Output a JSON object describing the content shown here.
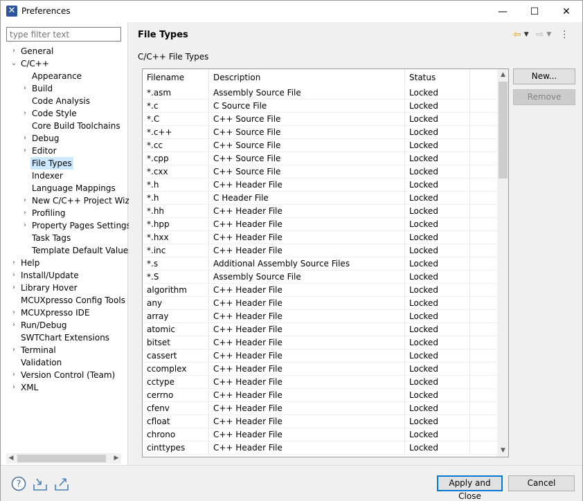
{
  "window": {
    "title": "Preferences",
    "controls": {
      "minimize": "—",
      "maximize": "☐",
      "close": "✕"
    }
  },
  "filter": {
    "placeholder": "type filter text"
  },
  "tree": [
    {
      "label": "General",
      "level": 0,
      "arrow": "›"
    },
    {
      "label": "C/C++",
      "level": 0,
      "arrow": "⌄"
    },
    {
      "label": "Appearance",
      "level": 1,
      "arrow": ""
    },
    {
      "label": "Build",
      "level": 1,
      "arrow": "›"
    },
    {
      "label": "Code Analysis",
      "level": 1,
      "arrow": ""
    },
    {
      "label": "Code Style",
      "level": 1,
      "arrow": "›"
    },
    {
      "label": "Core Build Toolchains",
      "level": 1,
      "arrow": ""
    },
    {
      "label": "Debug",
      "level": 1,
      "arrow": "›"
    },
    {
      "label": "Editor",
      "level": 1,
      "arrow": "›"
    },
    {
      "label": "File Types",
      "level": 1,
      "arrow": "",
      "selected": true
    },
    {
      "label": "Indexer",
      "level": 1,
      "arrow": ""
    },
    {
      "label": "Language Mappings",
      "level": 1,
      "arrow": ""
    },
    {
      "label": "New C/C++ Project Wiza",
      "level": 1,
      "arrow": "›"
    },
    {
      "label": "Profiling",
      "level": 1,
      "arrow": "›"
    },
    {
      "label": "Property Pages Settings",
      "level": 1,
      "arrow": "›"
    },
    {
      "label": "Task Tags",
      "level": 1,
      "arrow": ""
    },
    {
      "label": "Template Default Values",
      "level": 1,
      "arrow": ""
    },
    {
      "label": "Help",
      "level": 0,
      "arrow": "›"
    },
    {
      "label": "Install/Update",
      "level": 0,
      "arrow": "›"
    },
    {
      "label": "Library Hover",
      "level": 0,
      "arrow": "›"
    },
    {
      "label": "MCUXpresso Config Tools",
      "level": 0,
      "arrow": ""
    },
    {
      "label": "MCUXpresso IDE",
      "level": 0,
      "arrow": "›"
    },
    {
      "label": "Run/Debug",
      "level": 0,
      "arrow": "›"
    },
    {
      "label": "SWTChart Extensions",
      "level": 0,
      "arrow": ""
    },
    {
      "label": "Terminal",
      "level": 0,
      "arrow": "›"
    },
    {
      "label": "Validation",
      "level": 0,
      "arrow": ""
    },
    {
      "label": "Version Control (Team)",
      "level": 0,
      "arrow": "›"
    },
    {
      "label": "XML",
      "level": 0,
      "arrow": "›"
    }
  ],
  "page": {
    "title": "File Types",
    "subtitle": "C/C++ File Types",
    "columns": [
      "Filename",
      "Description",
      "Status"
    ],
    "rows": [
      [
        "*.asm",
        "Assembly Source File",
        "Locked"
      ],
      [
        "*.c",
        "C Source File",
        "Locked"
      ],
      [
        "*.C",
        "C++ Source File",
        "Locked"
      ],
      [
        "*.c++",
        "C++ Source File",
        "Locked"
      ],
      [
        "*.cc",
        "C++ Source File",
        "Locked"
      ],
      [
        "*.cpp",
        "C++ Source File",
        "Locked"
      ],
      [
        "*.cxx",
        "C++ Source File",
        "Locked"
      ],
      [
        "*.h",
        "C++ Header File",
        "Locked"
      ],
      [
        "*.h",
        "C Header File",
        "Locked"
      ],
      [
        "*.hh",
        "C++ Header File",
        "Locked"
      ],
      [
        "*.hpp",
        "C++ Header File",
        "Locked"
      ],
      [
        "*.hxx",
        "C++ Header File",
        "Locked"
      ],
      [
        "*.inc",
        "C++ Header File",
        "Locked"
      ],
      [
        "*.s",
        "Additional Assembly Source Files",
        "Locked"
      ],
      [
        "*.S",
        "Assembly Source File",
        "Locked"
      ],
      [
        "algorithm",
        "C++ Header File",
        "Locked"
      ],
      [
        "any",
        "C++ Header File",
        "Locked"
      ],
      [
        "array",
        "C++ Header File",
        "Locked"
      ],
      [
        "atomic",
        "C++ Header File",
        "Locked"
      ],
      [
        "bitset",
        "C++ Header File",
        "Locked"
      ],
      [
        "cassert",
        "C++ Header File",
        "Locked"
      ],
      [
        "ccomplex",
        "C++ Header File",
        "Locked"
      ],
      [
        "cctype",
        "C++ Header File",
        "Locked"
      ],
      [
        "cerrno",
        "C++ Header File",
        "Locked"
      ],
      [
        "cfenv",
        "C++ Header File",
        "Locked"
      ],
      [
        "cfloat",
        "C++ Header File",
        "Locked"
      ],
      [
        "chrono",
        "C++ Header File",
        "Locked"
      ],
      [
        "cinttypes",
        "C++ Header File",
        "Locked"
      ]
    ],
    "buttons": {
      "new": "New...",
      "remove": "Remove"
    }
  },
  "footer": {
    "apply_close": "Apply and Close",
    "cancel": "Cancel"
  },
  "colors": {
    "accent": "#0078d7",
    "selection": "#cce8ff"
  }
}
